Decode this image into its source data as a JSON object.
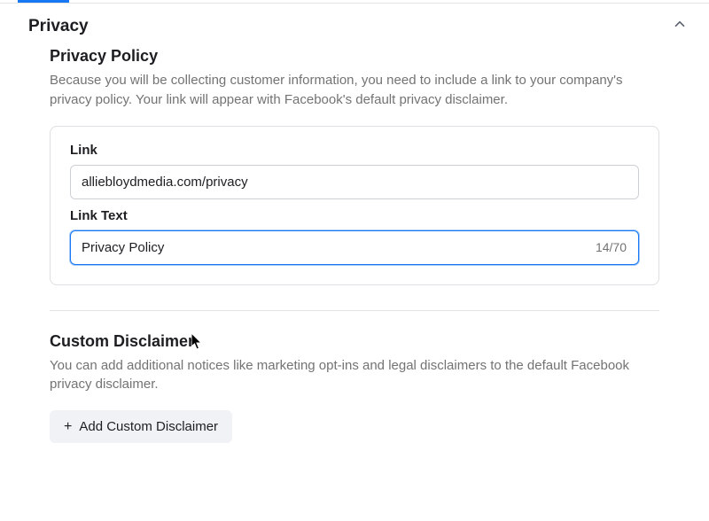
{
  "header": {
    "title": "Privacy"
  },
  "privacy_policy": {
    "title": "Privacy Policy",
    "description": "Because you will be collecting customer information, you need to include a link to your company's privacy policy. Your link will appear with Facebook's default privacy disclaimer.",
    "link_label": "Link",
    "link_value": "alliebloydmedia.com/privacy",
    "link_text_label": "Link Text",
    "link_text_value": "Privacy Policy",
    "counter": "14/70"
  },
  "custom_disclaimer": {
    "title": "Custom Disclaimer",
    "description": "You can add additional notices like marketing opt-ins and legal disclaimers to the default Facebook privacy disclaimer.",
    "button_label": "Add Custom Disclaimer"
  }
}
